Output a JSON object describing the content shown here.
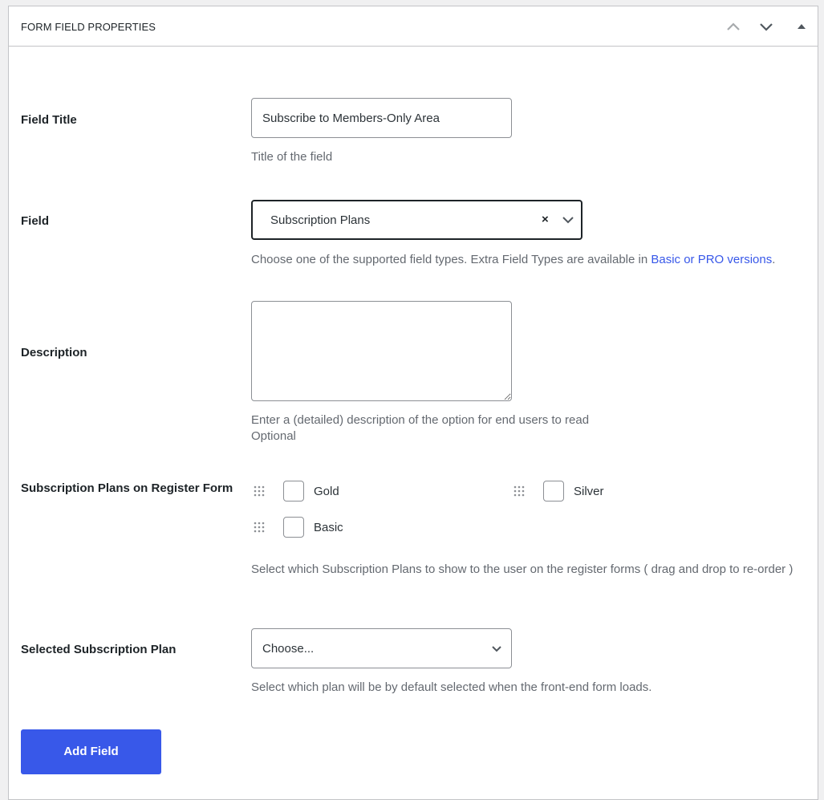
{
  "panel": {
    "title": "FORM FIELD PROPERTIES",
    "header_buttons": [
      {
        "icon": "chevron-up-icon",
        "label": "Move up"
      },
      {
        "icon": "chevron-down-icon",
        "label": "Move down"
      },
      {
        "icon": "triangle-up-icon",
        "label": "Toggle panel"
      }
    ]
  },
  "fields": {
    "field_title": {
      "label": "Field Title",
      "value": "Subscribe to Members-Only Area",
      "help": "Title of the field"
    },
    "field": {
      "label": "Field",
      "value": "Subscription Plans",
      "clear_glyph": "×",
      "help_prefix": "Choose one of the supported field types. Extra Field Types are available in ",
      "help_link": "Basic or PRO versions",
      "help_suffix": "."
    },
    "description": {
      "label": "Description",
      "value": "",
      "help_line1": "Enter a (detailed) description of the option for end users to read",
      "help_line2": "Optional"
    },
    "plans_on_register": {
      "label": "Subscription Plans on Register Form",
      "plans": [
        {
          "name": "Gold",
          "checked": false
        },
        {
          "name": "Silver",
          "checked": false
        },
        {
          "name": "Basic",
          "checked": false
        }
      ],
      "help": "Select which Subscription Plans to show to the user on the register forms ( drag and drop to re-order )"
    },
    "selected_plan": {
      "label": "Selected Subscription Plan",
      "value": "Choose...",
      "help": "Select which plan will be by default selected when the front-end form loads."
    }
  },
  "actions": {
    "add_field_label": "Add Field"
  },
  "colors": {
    "accent": "#3858e9",
    "border": "#8c8f94",
    "help_text": "#646970"
  }
}
